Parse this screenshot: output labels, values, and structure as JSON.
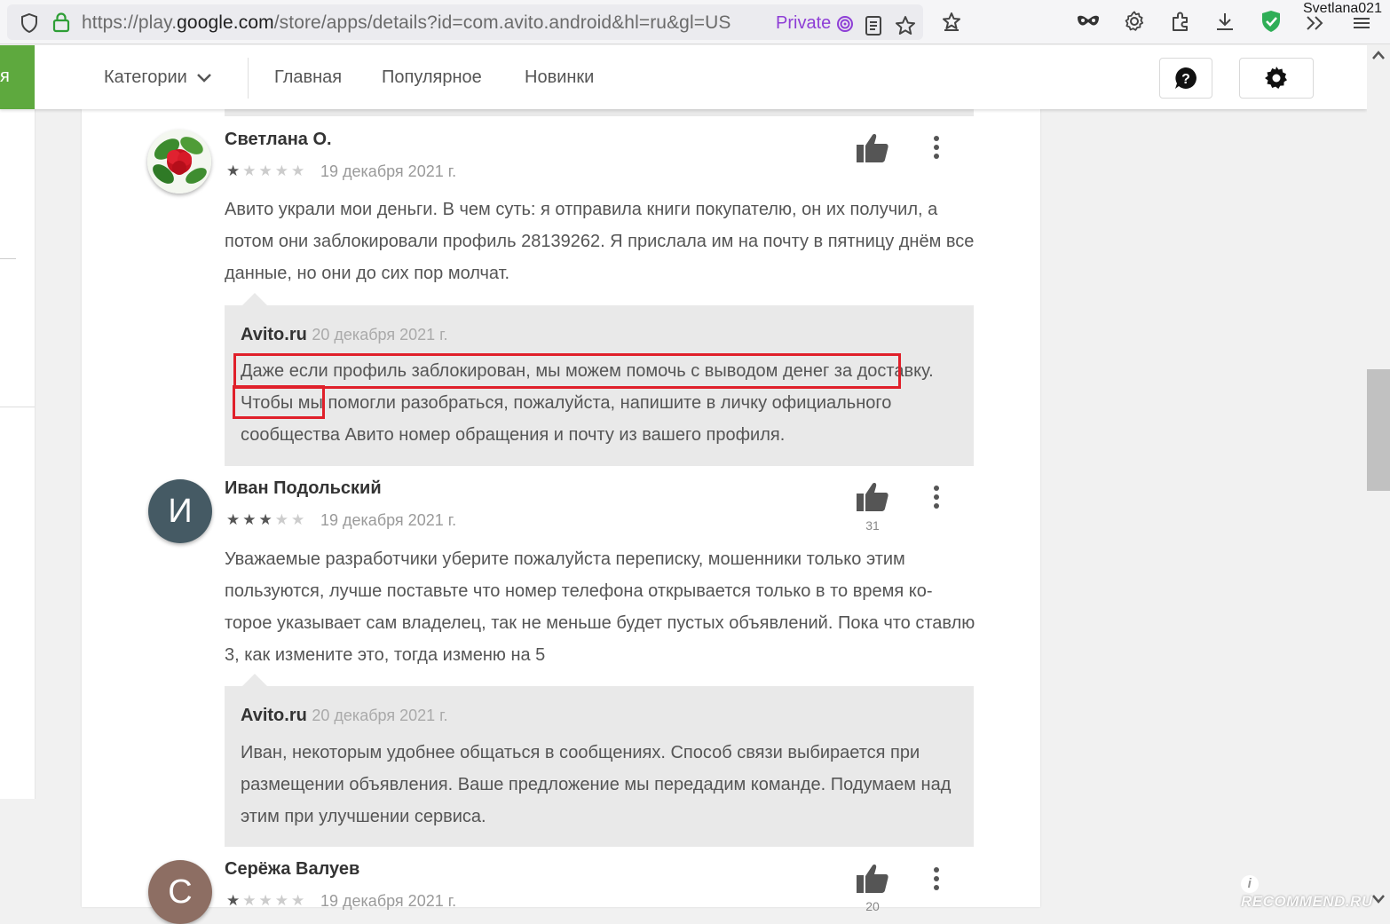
{
  "browser": {
    "url_prefix": "https://play.",
    "url_domain": "google.com",
    "url_path": "/store/apps/details?id=com.avito.android&hl=ru&gl=US",
    "private_label": "Private",
    "profile_name": "Svetlana021"
  },
  "header": {
    "left_tab_fragment": "я",
    "categories_label": "Категории",
    "nav": [
      "Главная",
      "Популярное",
      "Новинки"
    ]
  },
  "reviews": [
    {
      "author": "Светлана О.",
      "rating": 1,
      "date": "19 декабря 2021 г.",
      "helpful_count": "",
      "text": "Авито украли мои деньги. В чем суть: я отправила книги покупателю, он их получил, а потом они заблокировали профиль 28139262. Я прислала им на почту в пятницу днём все данные, но они до сих пор молчат.",
      "reply": {
        "developer": "Avito.ru",
        "date": "20 декабря 2021 г.",
        "text": "Даже если профиль заблокирован, мы можем помочь с выводом денег за доставку. Чтобы мы помогли разобраться, пожалуйста, напишите в личку официального сообщества Авито номер обращения и почту из вашего профиля."
      }
    },
    {
      "author": "Иван Подольский",
      "avatar_letter": "И",
      "avatar_color": "#455a64",
      "rating": 3,
      "date": "19 декабря 2021 г.",
      "helpful_count": "31",
      "text": "Уважаемые разработчики уберите пожалуйста переписку, мошенники только этим пользуются, лучше поставьте что номер телефона открывается только в то время ко-торое указывает сам владелец, так не меньше будет пустых объявлений. Пока что ставлю 3, как измените это, тогда изменю на 5",
      "reply": {
        "developer": "Avito.ru",
        "date": "20 декабря 2021 г.",
        "text": "Иван, некоторым удобнее общаться в сообщениях. Способ связи выбирается при размещении объявления. Ваше предложение мы передадим команде. Подумаем над этим при улучшении сервиса."
      }
    },
    {
      "author": "Серёжа Валуев",
      "avatar_letter": "С",
      "avatar_color": "#8d6e63",
      "rating": 1,
      "date": "19 декабря 2021 г.",
      "helpful_count": "20"
    }
  ],
  "watermark": "RECOMMEND.RU",
  "colors": {
    "accent_green": "#5ea93e",
    "highlight_red": "#e0202a",
    "private_purple": "#8e3ed6"
  }
}
